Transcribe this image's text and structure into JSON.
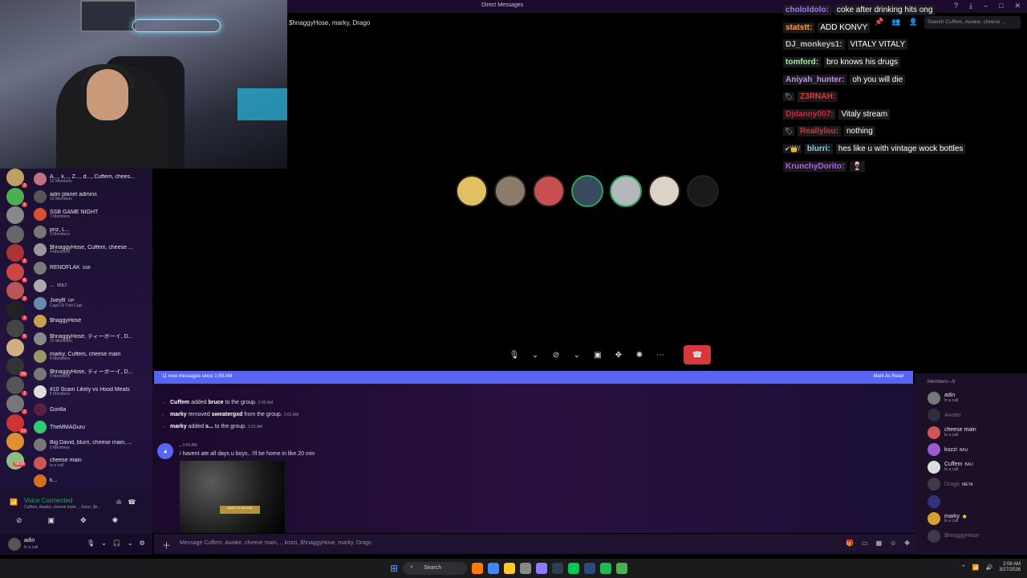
{
  "window": {
    "title": "Direct Messages",
    "chat_title": "$hnaggyHose, marky, Drago"
  },
  "twitch_chat": [
    {
      "name": "chololdolo:",
      "color": "#a970ff",
      "msg": "coke after drinking hits ong"
    },
    {
      "name": "statstt:",
      "color": "#ff9f40",
      "msg": "ADD KONVY"
    },
    {
      "name": "DJ_monkeys1:",
      "color": "#bfbfbf",
      "msg": "VITALY VITALY"
    },
    {
      "name": "tomford:",
      "color": "#9cf29c",
      "msg": "bro knows his drugs"
    },
    {
      "name": "Aniyah_hunter:",
      "color": "#c58cff",
      "msg": "oh you will die"
    },
    {
      "name": "Z3RNAH:",
      "color": "#d63b3b",
      "msg": "",
      "badge": "🏷"
    },
    {
      "name": "Djdanny007:",
      "color": "#d6233b",
      "msg": "Vitaly stream"
    },
    {
      "name": "Reallylou:",
      "color": "#c83b3b",
      "msg": "nothing",
      "badge": "🏷"
    },
    {
      "name": "blurri:",
      "color": "#7fd0ff",
      "msg": "hes like u with vintage wock bottles",
      "badge": "✔👑/"
    },
    {
      "name": "KrunchyDorito:",
      "color": "#b45cff",
      "msg": "🍷"
    }
  ],
  "search": {
    "placeholder": "Search Cuffem, Awake, cheese ..."
  },
  "call": {
    "avatars": [
      {
        "color": "#e0c060",
        "speaking": false
      },
      {
        "color": "#8c7b6b",
        "speaking": false
      },
      {
        "color": "#c95050",
        "speaking": false
      },
      {
        "color": "#3a4a5e",
        "speaking": true
      },
      {
        "color": "#b4b8bc",
        "speaking": true
      },
      {
        "color": "#ddd2c8",
        "speaking": false
      },
      {
        "color": "#1a1a1a",
        "speaking": false
      }
    ]
  },
  "servers": [
    {
      "color": "#c0a060",
      "badge": "2"
    },
    {
      "color": "#4caf50",
      "badge": "1"
    },
    {
      "color": "#888",
      "badge": ""
    },
    {
      "color": "#666",
      "badge": ""
    },
    {
      "color": "#a33",
      "badge": "1"
    },
    {
      "color": "#c44",
      "badge": "6"
    },
    {
      "color": "#b55",
      "badge": "2"
    },
    {
      "color": "#222",
      "badge": "1"
    },
    {
      "color": "#444",
      "badge": "5"
    },
    {
      "color": "#d0b080",
      "badge": ""
    },
    {
      "color": "#333",
      "badge": "29"
    },
    {
      "color": "#555",
      "badge": "1"
    },
    {
      "color": "#777",
      "badge": "3"
    },
    {
      "color": "#c33",
      "badge": "22"
    },
    {
      "color": "#e09030",
      "badge": ""
    },
    {
      "color": "#8fbf80",
      "badge": "NEW"
    }
  ],
  "dms": [
    {
      "name": "A..., k..., Z..., d..., Cuffem, chees...",
      "sub": "10 Members",
      "color": "#c07080",
      "tag": ""
    },
    {
      "name": "adin planet admins",
      "sub": "10 Members",
      "color": "#555",
      "tag": ""
    },
    {
      "name": "SSB GAME NIGHT",
      "sub": "7 Members",
      "color": "#d95030",
      "tag": ""
    },
    {
      "name": "priz, L...",
      "sub": "3 Members",
      "color": "#777",
      "tag": ""
    },
    {
      "name": "$hnaggyHose, Cuffem, cheese ...",
      "sub": "4 Members",
      "color": "#999",
      "tag": ""
    },
    {
      "name": "RENOFLAK",
      "sub": "",
      "color": "#7a7a7a",
      "tag": "SSB"
    },
    {
      "name": "...",
      "sub": "",
      "color": "#aaa",
      "tag": "VOLT"
    },
    {
      "name": "JoeyB",
      "sub": "Capo Di Tutti Capi",
      "color": "#6a8aaa",
      "tag": "VIP"
    },
    {
      "name": "$haggyHose",
      "sub": "",
      "color": "#c9a050",
      "tag": ""
    },
    {
      "name": "$hnaggyHose, ディーボーイ, D...",
      "sub": "10 Members",
      "color": "#888",
      "tag": ""
    },
    {
      "name": "marky, Cuffem, cheese main",
      "sub": "4 Members",
      "color": "#996",
      "tag": ""
    },
    {
      "name": "$hnaggyHose, ディーボーイ, D...",
      "sub": "9 Members",
      "color": "#777",
      "tag": ""
    },
    {
      "name": "#10 Scam Likely vs Hood Meals",
      "sub": "5 Members",
      "color": "#ddd",
      "tag": ""
    },
    {
      "name": "Gorilla",
      "sub": "",
      "color": "#5a2040",
      "tag": ""
    },
    {
      "name": "TheMMAGuru",
      "sub": "",
      "color": "#2ecc71",
      "tag": ""
    },
    {
      "name": "Big David, blurri, cheese main, ...",
      "sub": "5 Members",
      "color": "#777",
      "tag": ""
    },
    {
      "name": "cheese main",
      "sub": "In a call",
      "color": "#c55",
      "tag": ""
    },
    {
      "name": "k...",
      "sub": "",
      "color": "#d47020",
      "tag": ""
    }
  ],
  "voice": {
    "title": "Voice Connected",
    "sub": "Cuffem, Awake, cheese main, ., kozzi, $h..."
  },
  "user": {
    "name": "adin",
    "status": "In a call"
  },
  "banner": {
    "left": "11 new messages since 1:59 AM",
    "right": "Mark As Read"
  },
  "messages": {
    "sys1": {
      "actor": "Cuffem",
      "verb": "added",
      "target": "bruce",
      "rest": "to the group.",
      "time": "2:00 AM"
    },
    "sys2": {
      "actor": "marky",
      "verb": "removed",
      "target": "sweatergxd",
      "rest": "from the group.",
      "time": "2:01 AM"
    },
    "sys3": {
      "actor": "marky",
      "verb": "added",
      "target": "s...",
      "rest": "to the group.",
      "time": "2:01 AM"
    },
    "msg": {
      "author": ".",
      "time": "2:04 AM",
      "text": "i havent ate all days u boys.. i'll be home in like 20 min"
    },
    "image_sign": "WAFFLE HOUSE"
  },
  "composer": {
    "placeholder": "Message Cuffem, Awake, cheese main, ., kozzi, $hnaggyHose, marky, Drago"
  },
  "members": {
    "header": "Members—9",
    "list": [
      {
        "name": "adin",
        "sub": "In a call",
        "tag": "",
        "color": "#777",
        "off": false
      },
      {
        "name": "Awake",
        "sub": "",
        "tag": "",
        "color": "#555",
        "off": true
      },
      {
        "name": "cheese main",
        "sub": "In a call",
        "tag": "",
        "color": "#c55",
        "off": false
      },
      {
        "name": "kozzi",
        "sub": "",
        "tag": "BAU",
        "color": "#9a5ad0",
        "off": false
      },
      {
        "name": "Cuffem",
        "sub": "In a call",
        "tag": "BAU",
        "color": "#ddd",
        "off": false
      },
      {
        "name": "Drago",
        "sub": "",
        "tag": "META",
        "color": "#777",
        "off": true
      },
      {
        "name": "",
        "sub": "",
        "tag": "",
        "color": "#5865f2",
        "off": true
      },
      {
        "name": "marky",
        "sub": "In a call",
        "tag": "⭐",
        "color": "#d9a030",
        "off": false
      },
      {
        "name": "$hnaggyHose",
        "sub": "",
        "tag": "",
        "color": "#777",
        "off": true
      }
    ]
  },
  "taskbar": {
    "search": "Search",
    "time": "2:08 AM",
    "date": "3/27/2026",
    "apps": [
      "#ff7a00",
      "#4285f4",
      "#ffca28",
      "#888",
      "#8a7cff",
      "#2c3e50",
      "#00c853",
      "#2c4a7a",
      "#1db954",
      "#4caf50"
    ]
  }
}
